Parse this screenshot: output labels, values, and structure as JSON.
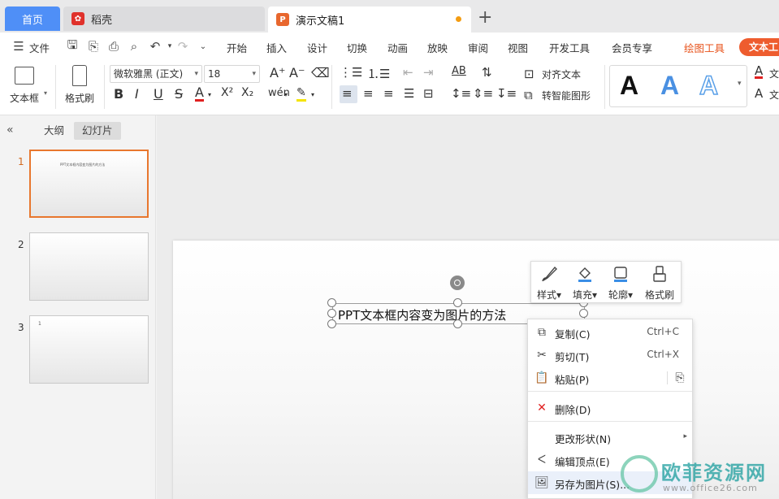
{
  "tabs": {
    "home": "首页",
    "daoke": "稻壳",
    "document": "演示文稿1",
    "add": "+"
  },
  "menu": {
    "file": "文件",
    "items": [
      "开始",
      "插入",
      "设计",
      "切换",
      "动画",
      "放映",
      "审阅",
      "视图",
      "开发工具",
      "会员专享"
    ],
    "drawing_tools": "绘图工具",
    "text_tools": "文本工"
  },
  "ribbon": {
    "textbox": "文本框",
    "format_painter": "格式刷",
    "font_name": "微软雅黑 (正文)",
    "font_size": "18",
    "align_text": "对齐文本",
    "smart_shape": "转智能图形",
    "wordart_letters": [
      "A",
      "A",
      "A"
    ],
    "text_fill_label": "文",
    "text_outline_label": "文"
  },
  "panel": {
    "outline_tab": "大纲",
    "slides_tab": "幻灯片",
    "slides": [
      {
        "num": "1",
        "text": "PPT文本框内容变为图片的方法"
      },
      {
        "num": "2",
        "text": ""
      },
      {
        "num": "3",
        "text": "1"
      }
    ]
  },
  "slide": {
    "textbox_text": "PPT文本框内容变为图片的方法"
  },
  "floatbar": {
    "style": "样式",
    "fill": "填充",
    "outline": "轮廓",
    "format_painter": "格式刷"
  },
  "context_menu": {
    "copy": "复制(C)",
    "copy_sc": "Ctrl+C",
    "cut": "剪切(T)",
    "cut_sc": "Ctrl+X",
    "paste": "粘贴(P)",
    "delete": "删除(D)",
    "change_shape": "更改形状(N)",
    "edit_points": "编辑顶点(E)",
    "save_as_picture": "另存为图片(S)..."
  },
  "watermark": {
    "title": "欧菲资源网",
    "sub": "www.office26.com"
  },
  "colors": {
    "home_tab": "#4f8ff7",
    "accent_orange": "#e8551f",
    "active_slide_border": "#e8772e"
  }
}
